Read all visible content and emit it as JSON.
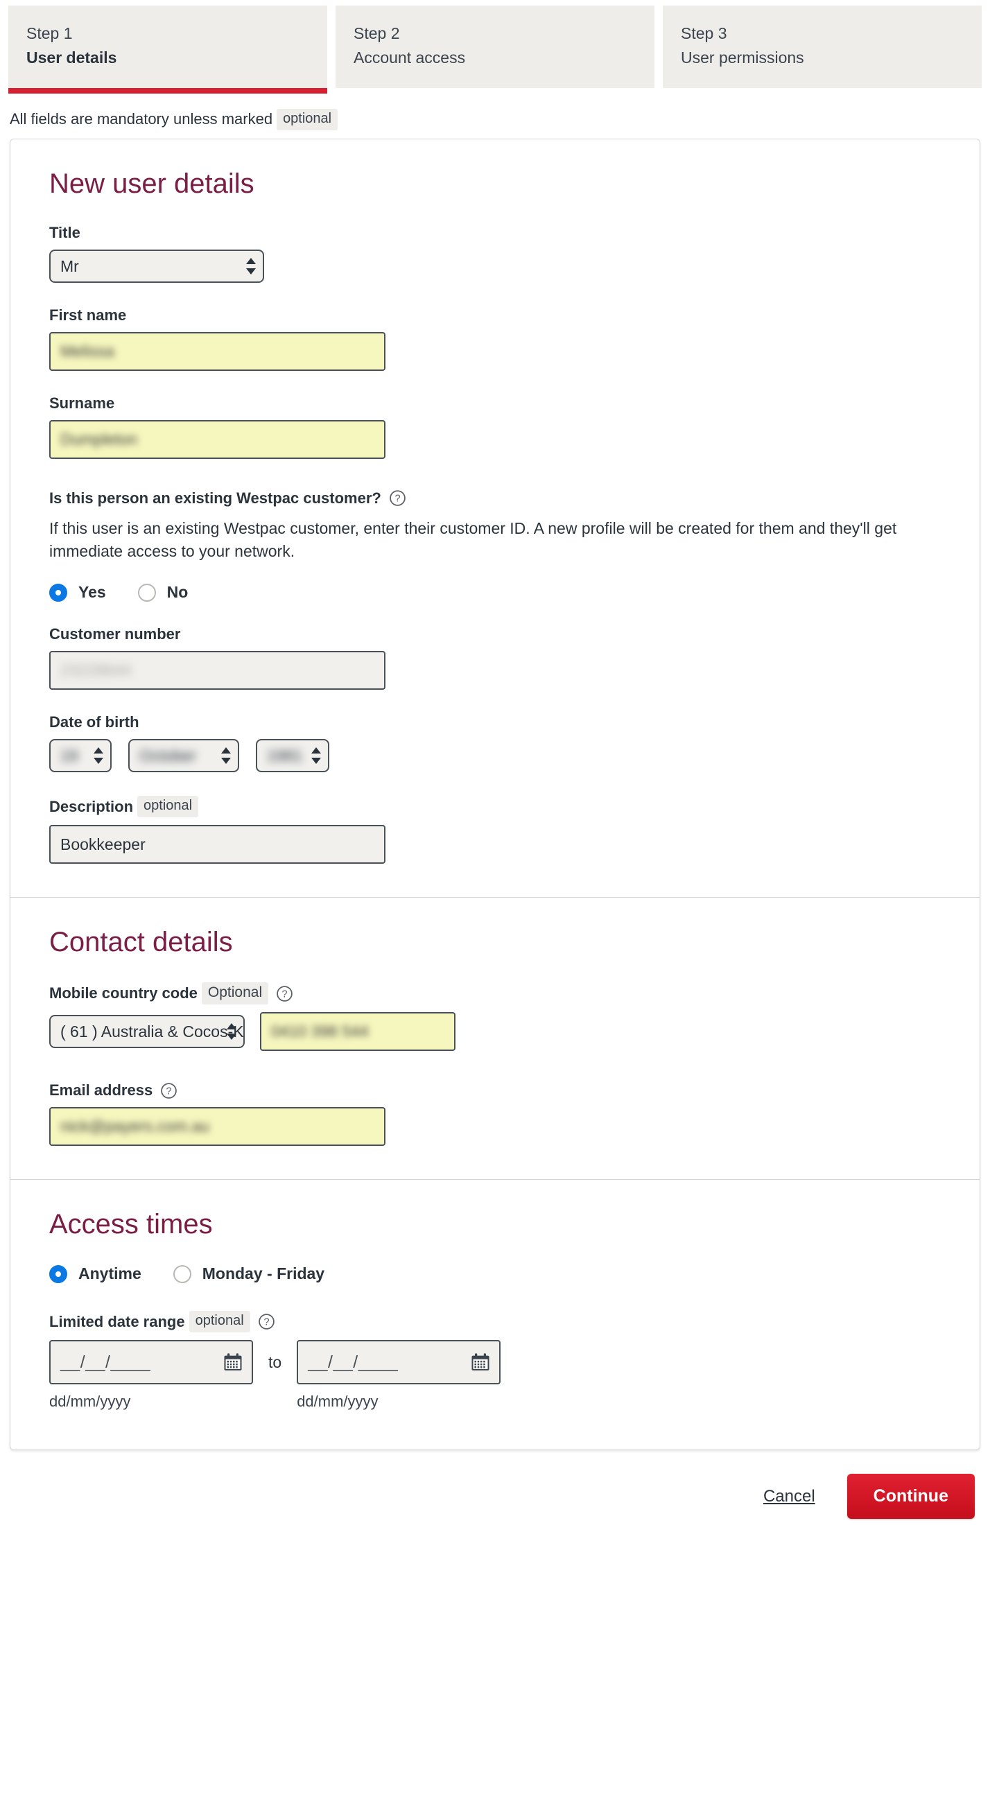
{
  "stepper": {
    "steps": [
      {
        "number": "Step 1",
        "title": "User details",
        "active": true
      },
      {
        "number": "Step 2",
        "title": "Account access",
        "active": false
      },
      {
        "number": "Step 3",
        "title": "User permissions",
        "active": false
      }
    ]
  },
  "mandatory_note": {
    "text": "All fields are mandatory unless marked",
    "badge": "optional"
  },
  "sections": {
    "user_details": {
      "title": "New user details",
      "title_field": {
        "label": "Title",
        "value": "Mr"
      },
      "first_name": {
        "label": "First name",
        "value": "Melissa"
      },
      "surname": {
        "label": "Surname",
        "value": "Dumpleton"
      },
      "existing_customer": {
        "label": "Is this person an existing Westpac customer?",
        "help": "help-icon",
        "description": "If this user is an existing Westpac customer, enter their customer ID. A new profile will be created for them and they'll get immediate access to your network.",
        "options": [
          {
            "label": "Yes",
            "selected": true
          },
          {
            "label": "No",
            "selected": false
          }
        ]
      },
      "customer_number": {
        "label": "Customer number",
        "value": "23228644"
      },
      "date_of_birth": {
        "label": "Date of birth",
        "day": "19",
        "month": "October",
        "year": "1981"
      },
      "description": {
        "label": "Description",
        "badge": "optional",
        "value": "Bookkeeper"
      }
    },
    "contact_details": {
      "title": "Contact details",
      "mobile_country_code": {
        "label": "Mobile country code",
        "badge": "Optional",
        "help": "help-icon",
        "value": "( 61 ) Australia & Cocos-K"
      },
      "mobile_number": {
        "value": "0410 398 544"
      },
      "email": {
        "label": "Email address",
        "help": "help-icon",
        "value": "nick@payers.com.au"
      }
    },
    "access_times": {
      "title": "Access times",
      "options": [
        {
          "label": "Anytime",
          "selected": true
        },
        {
          "label": "Monday - Friday",
          "selected": false
        }
      ],
      "limited_date_range": {
        "label": "Limited date range",
        "badge": "optional",
        "help": "help-icon",
        "from_mask": "__/__/____",
        "to_word": "to",
        "to_mask": "__/__/____",
        "from_hint": "dd/mm/yyyy",
        "to_hint": "dd/mm/yyyy",
        "calendar_icon": "calendar-icon"
      }
    }
  },
  "footer": {
    "cancel_label": "Cancel",
    "continue_label": "Continue"
  },
  "colors": {
    "accent_red": "#d5202f",
    "heading_plum": "#7b1e45",
    "radio_blue": "#0b78e3",
    "field_yellow": "#f6f7bf",
    "field_grey": "#f1f0ed"
  }
}
